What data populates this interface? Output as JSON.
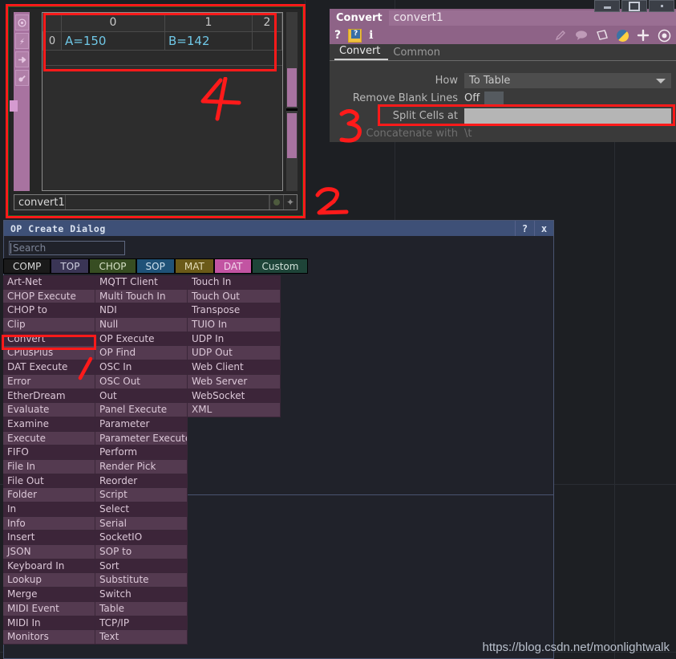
{
  "window_buttons": [
    {
      "name": "minimize",
      "glyph": "minimize-icon"
    },
    {
      "name": "maximize",
      "glyph": "maximize-icon"
    },
    {
      "name": "close",
      "glyph": "close-icon"
    }
  ],
  "dat_viewer": {
    "op_flag_icons": [
      "viewer-flag-icon",
      "bypass-flag-icon",
      "display-flag-icon",
      "lock-flag-icon"
    ],
    "table": {
      "corner": "",
      "column_headers": [
        "0",
        "1",
        "2"
      ],
      "rows": [
        {
          "row_header": "0",
          "cells": [
            "A=150",
            "B=142",
            ""
          ]
        }
      ]
    },
    "name_field": "convert1"
  },
  "parameters": {
    "op_type": "Convert",
    "op_name": "convert1",
    "left_icons": [
      "help-question-icon",
      "help-box-icon",
      "info-icon"
    ],
    "right_icons": [
      "pencil-icon",
      "comment-icon",
      "clone-icon",
      "python-icon",
      "plus-icon",
      "target-icon"
    ],
    "tabs": [
      {
        "label": "Convert",
        "active": true
      },
      {
        "label": "Common",
        "active": false
      }
    ],
    "rows": [
      {
        "label": "How",
        "type": "menu",
        "value": "To Table"
      },
      {
        "label": "Remove Blank Lines",
        "type": "toggle",
        "value": "Off"
      },
      {
        "label": "Split Cells at",
        "type": "field",
        "value": ""
      },
      {
        "label": "Concatenate with",
        "type": "static",
        "value": "\\t",
        "dim": true
      }
    ]
  },
  "op_create_dialog": {
    "title": "OP Create Dialog",
    "help_button": "?",
    "close_button": "x",
    "search_placeholder": "Search",
    "search_value": "",
    "family_tabs": [
      {
        "label": "COMP",
        "bg": "#1a1a1a",
        "fg": "#d8d8d8",
        "active": true
      },
      {
        "label": "TOP",
        "bg": "#3a3555",
        "fg": "#cfd0e0",
        "active": false
      },
      {
        "label": "CHOP",
        "bg": "#374d22",
        "fg": "#d5e0c5",
        "active": false
      },
      {
        "label": "SOP",
        "bg": "#1f5278",
        "fg": "#cfe2ef",
        "active": false
      },
      {
        "label": "MAT",
        "bg": "#6b5a18",
        "fg": "#e4dcb8",
        "active": false
      },
      {
        "label": "DAT",
        "bg": "#c254a2",
        "fg": "#f3d6ec",
        "active": false
      },
      {
        "label": "Custom",
        "bg": "#1e4438",
        "fg": "#cfe0d8",
        "active": false
      }
    ],
    "selected_tab": "DAT",
    "columns": [
      [
        "Art-Net",
        "CHOP Execute",
        "CHOP to",
        "Clip",
        "Convert",
        "CPlusPlus",
        "DAT Execute",
        "Error",
        "EtherDream",
        "Evaluate",
        "Examine",
        "Execute",
        "FIFO",
        "File In",
        "File Out",
        "Folder",
        "In",
        "Info",
        "Insert",
        "JSON",
        "Keyboard In",
        "Lookup",
        "Merge",
        "MIDI Event",
        "MIDI In",
        "Monitors"
      ],
      [
        "MQTT Client",
        "Multi Touch In",
        "NDI",
        "Null",
        "OP Execute",
        "OP Find",
        "OSC In",
        "OSC Out",
        "Out",
        "Panel Execute",
        "Parameter",
        "Parameter Execute",
        "Perform",
        "Render Pick",
        "Reorder",
        "Script",
        "Select",
        "Serial",
        "SocketIO",
        "SOP to",
        "Sort",
        "Substitute",
        "Switch",
        "Table",
        "TCP/IP",
        "Text"
      ],
      [
        "Touch In",
        "Touch Out",
        "Transpose",
        "TUIO In",
        "UDP In",
        "UDP Out",
        "Web Client",
        "Web Server",
        "WebSocket",
        "XML"
      ]
    ],
    "highlighted_item": "Convert"
  },
  "annotations": [
    {
      "name": "annotation-1",
      "text": "1",
      "kind": "stroke"
    },
    {
      "name": "annotation-2",
      "text": "2",
      "kind": "digit"
    },
    {
      "name": "annotation-3",
      "text": "3",
      "kind": "digit"
    },
    {
      "name": "annotation-4",
      "text": "4",
      "kind": "digit"
    }
  ],
  "watermark": "https://blog.csdn.net/moonlightwalk",
  "colors": {
    "accent_pink": "#8e6387",
    "annotation_red": "#ff1a1a",
    "dialog_blue": "#3e5077",
    "dat_magenta": "#c254a2",
    "cell_text_blue": "#6fc7e6",
    "panel_green_border": "#1d5c22"
  }
}
